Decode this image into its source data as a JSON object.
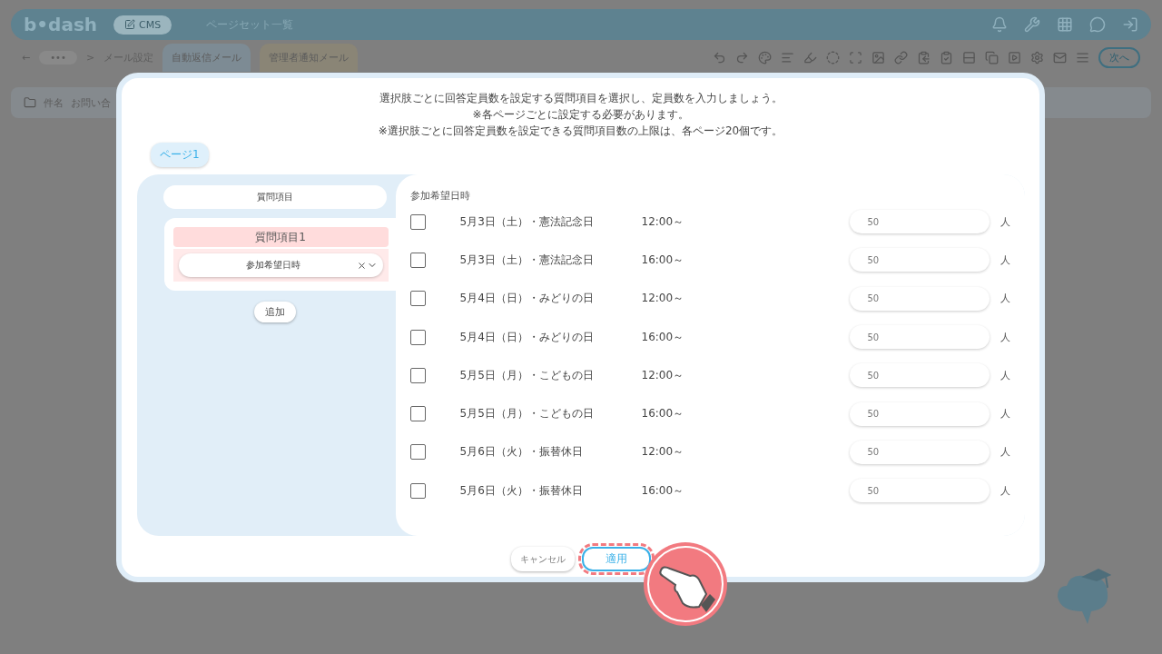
{
  "app": {
    "logo": "b•dash",
    "module": "CMS",
    "page_title": "ページセット一覧",
    "back": "←",
    "more": "•••",
    "breadcrumb_sep": ">",
    "breadcrumb": "メール設定",
    "tabs": [
      {
        "label": "自動返信メール",
        "selected": true
      },
      {
        "label": "管理者通知メール",
        "selected": false
      }
    ],
    "next": "次へ",
    "subject_label": "件名",
    "subject_value": "お問い合"
  },
  "modal": {
    "instruction": "選択肢ごとに回答定員数を設定する質問項目を選択し、定員数を入力しましょう。",
    "notes": [
      "※各ページごとに設定する必要があります。",
      "※選択肢ごとに回答定員数を設定できる質問項目数の上限は、各ページ20個です。"
    ],
    "page_tabs": [
      {
        "label": "ページ1",
        "selected": true
      }
    ],
    "left_header": "質問項目",
    "questions": [
      {
        "title": "質問項目1",
        "value": "参加希望日時"
      }
    ],
    "add": "追加",
    "right_header": "参加希望日時",
    "rows": [
      {
        "label": "5月3日（土）・憲法記念日",
        "time": "12:00～",
        "checked": false,
        "capacity": "50",
        "unit": "人"
      },
      {
        "label": "5月3日（土）・憲法記念日",
        "time": "16:00～",
        "checked": false,
        "capacity": "50",
        "unit": "人"
      },
      {
        "label": "5月4日（日）・みどりの日",
        "time": "12:00～",
        "checked": false,
        "capacity": "50",
        "unit": "人"
      },
      {
        "label": "5月4日（日）・みどりの日",
        "time": "16:00～",
        "checked": false,
        "capacity": "50",
        "unit": "人"
      },
      {
        "label": "5月5日（月）・こどもの日",
        "time": "12:00～",
        "checked": false,
        "capacity": "50",
        "unit": "人"
      },
      {
        "label": "5月5日（月）・こどもの日",
        "time": "16:00～",
        "checked": false,
        "capacity": "50",
        "unit": "人"
      },
      {
        "label": "5月6日（火）・振替休日",
        "time": "12:00～",
        "checked": false,
        "capacity": "50",
        "unit": "人"
      },
      {
        "label": "5月6日（火）・振替休日",
        "time": "16:00～",
        "checked": false,
        "capacity": "50",
        "unit": "人"
      }
    ],
    "cancel": "キャンセル",
    "apply": "適用"
  }
}
